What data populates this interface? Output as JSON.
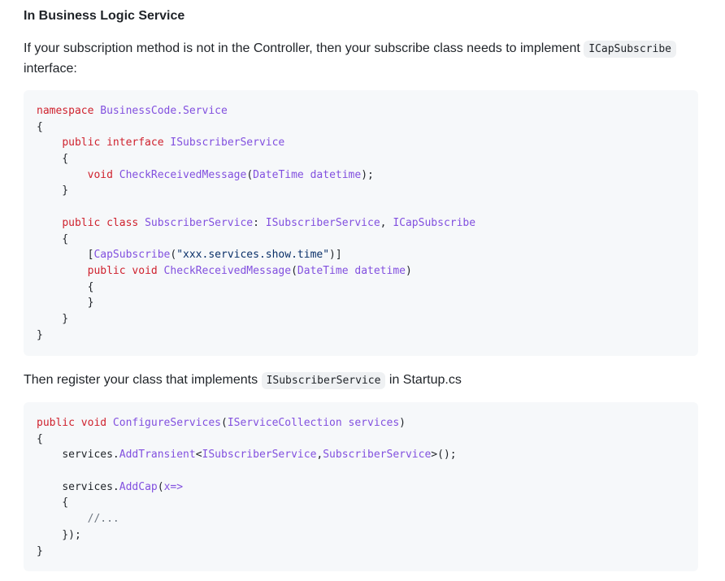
{
  "heading": "In Business Logic Service",
  "para1": {
    "before": "If your subscription method is not in the Controller, then your subscribe class needs to implement ",
    "code": "ICapSubscribe",
    "after": " interface:"
  },
  "code1": {
    "l1": {
      "kw": "namespace",
      "ty": "BusinessCode.Service"
    },
    "l2": "{",
    "l3": {
      "kw": "public interface",
      "ty": "ISubscriberService"
    },
    "l4": "    {",
    "l5": {
      "kw": "void",
      "fn": "CheckReceivedMessage",
      "p1": "(",
      "ty": "DateTime",
      "arg": "datetime",
      "p2": ");"
    },
    "l6": "    }",
    "l7": "",
    "l8": {
      "kw": "public class",
      "ty1": "SubscriberService",
      "colon": ": ",
      "ty2": "ISubscriberService",
      "comma": ", ",
      "ty3": "ICapSubscribe"
    },
    "l9": "    {",
    "l10": {
      "open": "[",
      "ty": "CapSubscribe",
      "p1": "(",
      "st": "\"xxx.services.show.time\"",
      "p2": ")]"
    },
    "l11": {
      "kw": "public void",
      "fn": "CheckReceivedMessage",
      "p1": "(",
      "ty": "DateTime",
      "arg": "datetime",
      "p2": ")"
    },
    "l12": "        {",
    "l13": "        }",
    "l14": "    }",
    "l15": "}"
  },
  "para2": {
    "before": "Then register your class that implements ",
    "code": "ISubscriberService",
    "after": " in Startup.cs"
  },
  "code2": {
    "l1": {
      "kw": "public void",
      "fn": "ConfigureServices",
      "p1": "(",
      "ty": "IServiceCollection",
      "arg": "services",
      "p2": ")"
    },
    "l2": "{",
    "l3": {
      "obj": "services.",
      "fn": "AddTransient",
      "lt": "<",
      "ty1": "ISubscriberService",
      "comma": ",",
      "ty2": "SubscriberService",
      "gt": ">();"
    },
    "l4": "",
    "l5": {
      "obj": "services.",
      "fn": "AddCap",
      "p1": "(",
      "arg": "x=>"
    },
    "l6": "    {",
    "l7": {
      "cm": "//..."
    },
    "l8": "    });",
    "l9": "}"
  }
}
